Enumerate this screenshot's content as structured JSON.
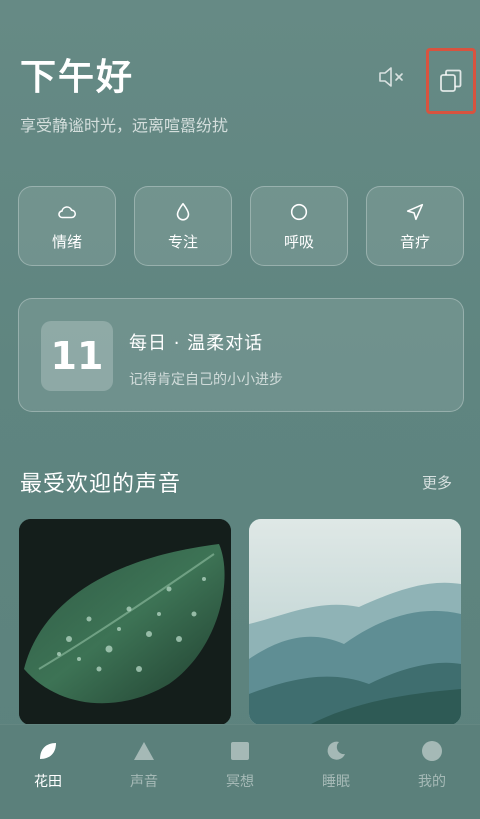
{
  "header": {
    "greeting": "下午好",
    "subtitle": "享受静谧时光，远离喧嚣纷扰"
  },
  "icons": {
    "mute": "speaker-mute-icon",
    "copy": "copy-icon"
  },
  "categories": [
    {
      "label": "情绪",
      "icon": "cloud-icon"
    },
    {
      "label": "专注",
      "icon": "drop-icon"
    },
    {
      "label": "呼吸",
      "icon": "circle-icon"
    },
    {
      "label": "音疗",
      "icon": "send-arrow-icon"
    }
  ],
  "daily": {
    "day": "11",
    "title": "每日 · 温柔对话",
    "subtitle": "记得肯定自己的小小进步"
  },
  "popular": {
    "title": "最受欢迎的声音",
    "more": "更多"
  },
  "tabs": [
    {
      "label": "花田",
      "icon": "leaf-icon",
      "active": true
    },
    {
      "label": "声音",
      "icon": "triangle-icon",
      "active": false
    },
    {
      "label": "冥想",
      "icon": "square-icon",
      "active": false
    },
    {
      "label": "睡眠",
      "icon": "moon-icon",
      "active": false
    },
    {
      "label": "我的",
      "icon": "profile-circle-icon",
      "active": false
    }
  ],
  "colors": {
    "background": "#5f8580",
    "highlight_border": "#d8533f"
  }
}
